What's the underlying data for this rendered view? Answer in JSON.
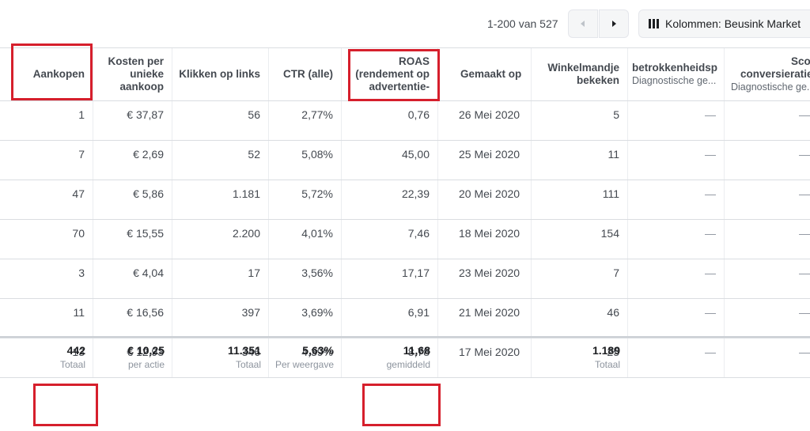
{
  "pagination": {
    "range": "1-200 van 527"
  },
  "columns_button": {
    "label": "Kolommen: Beusink Market"
  },
  "headers": {
    "aankopen": "Aankopen",
    "kosten": [
      "Kosten per",
      "unieke",
      "aankoop"
    ],
    "klikken": "Klikken op links",
    "ctr": "CTR (alle)",
    "roas": [
      "ROAS",
      "(rendement op",
      "advertentie-"
    ],
    "gemaakt": "Gemaakt op",
    "winkel": [
      "Winkelmandje",
      "bekeken"
    ],
    "betrokken": {
      "title": "betrokkenheidsp",
      "sub": "Diagnostische ge..."
    },
    "score": {
      "title": [
        "Score",
        "conversieratie"
      ],
      "sub": "Diagnostische ge..."
    }
  },
  "rows": [
    {
      "aankopen": "1",
      "kosten": "€ 37,87",
      "klikken": "56",
      "ctr": "2,77%",
      "roas": "0,76",
      "gemaakt": "26 Mei 2020",
      "winkel": "5",
      "betrokken": "—",
      "score": "—"
    },
    {
      "aankopen": "7",
      "kosten": "€ 2,69",
      "klikken": "52",
      "ctr": "5,08%",
      "roas": "45,00",
      "gemaakt": "25 Mei 2020",
      "winkel": "11",
      "betrokken": "—",
      "score": "—"
    },
    {
      "aankopen": "47",
      "kosten": "€ 5,86",
      "klikken": "1.181",
      "ctr": "5,72%",
      "roas": "22,39",
      "gemaakt": "20 Mei 2020",
      "winkel": "111",
      "betrokken": "—",
      "score": "—"
    },
    {
      "aankopen": "70",
      "kosten": "€ 15,55",
      "klikken": "2.200",
      "ctr": "4,01%",
      "roas": "7,46",
      "gemaakt": "18 Mei 2020",
      "winkel": "154",
      "betrokken": "—",
      "score": "—"
    },
    {
      "aankopen": "3",
      "kosten": "€ 4,04",
      "klikken": "17",
      "ctr": "3,56%",
      "roas": "17,17",
      "gemaakt": "23 Mei 2020",
      "winkel": "7",
      "betrokken": "—",
      "score": "—"
    },
    {
      "aankopen": "11",
      "kosten": "€ 16,56",
      "klikken": "397",
      "ctr": "3,69%",
      "roas": "6,91",
      "gemaakt": "21 Mei 2020",
      "winkel": "46",
      "betrokken": "—",
      "score": "—"
    },
    {
      "aankopen": "13",
      "kosten": "€ 12,93",
      "klikken": "346",
      "ctr": "4,39%",
      "roas": "8,78",
      "gemaakt": "17 Mei 2020",
      "winkel": "25",
      "betrokken": "—",
      "score": "—"
    }
  ],
  "totals": {
    "aankopen": {
      "value": "442",
      "label": "Totaal"
    },
    "kosten": {
      "value": "€ 10,25",
      "label": "per actie"
    },
    "klikken": {
      "value": "11.351",
      "label": "Totaal"
    },
    "ctr": {
      "value": "5,63%",
      "label": "Per weergave"
    },
    "roas": {
      "value": "11,68",
      "label": "gemiddeld"
    },
    "winkel": {
      "value": "1.189",
      "label": "Totaal"
    }
  },
  "colors": {
    "highlight": "#d61f2c",
    "header_text": "#444950",
    "border": "#dadde1"
  },
  "icons": {
    "prev": "chevron-left-icon",
    "next": "chevron-right-icon",
    "columns": "columns-icon"
  }
}
